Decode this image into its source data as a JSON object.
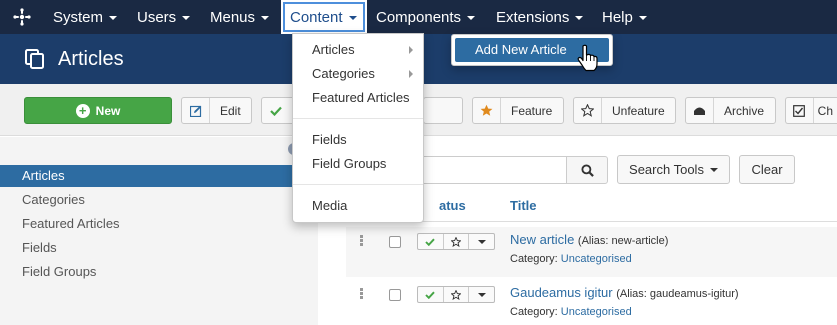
{
  "nav": {
    "items": [
      {
        "label": "System"
      },
      {
        "label": "Users"
      },
      {
        "label": "Menus"
      },
      {
        "label": "Content"
      },
      {
        "label": "Components"
      },
      {
        "label": "Extensions"
      },
      {
        "label": "Help"
      }
    ]
  },
  "page": {
    "title": "Articles"
  },
  "toolbar": {
    "new_label": "New",
    "edit_label": "Edit",
    "feature_label": "Feature",
    "unfeature_label": "Unfeature",
    "archive_label": "Archive",
    "checkin_label": "Ch"
  },
  "content_menu": {
    "items": [
      "Articles",
      "Categories",
      "Featured Articles",
      "Fields",
      "Field Groups",
      "Media"
    ],
    "submenu_item": "Add New Article"
  },
  "sidebar": {
    "items": [
      "Articles",
      "Categories",
      "Featured Articles",
      "Fields",
      "Field Groups"
    ]
  },
  "filters": {
    "search_tools_label": "Search Tools",
    "clear_label": "Clear"
  },
  "table": {
    "status_header": "atus",
    "title_header": "Title",
    "rows": [
      {
        "title": "New article",
        "alias": "(Alias: new-article)",
        "category_prefix": "Category:",
        "category": "Uncategorised"
      },
      {
        "title": "Gaudeamus igitur",
        "alias": "(Alias: gaudeamus-igitur)",
        "category_prefix": "Category:",
        "category": "Uncategorised"
      }
    ]
  },
  "colors": {
    "nav_bg": "#1a2943",
    "title_bg": "#1c3d6a",
    "accent": "#2d6ca2",
    "new_button": "#46a546"
  }
}
